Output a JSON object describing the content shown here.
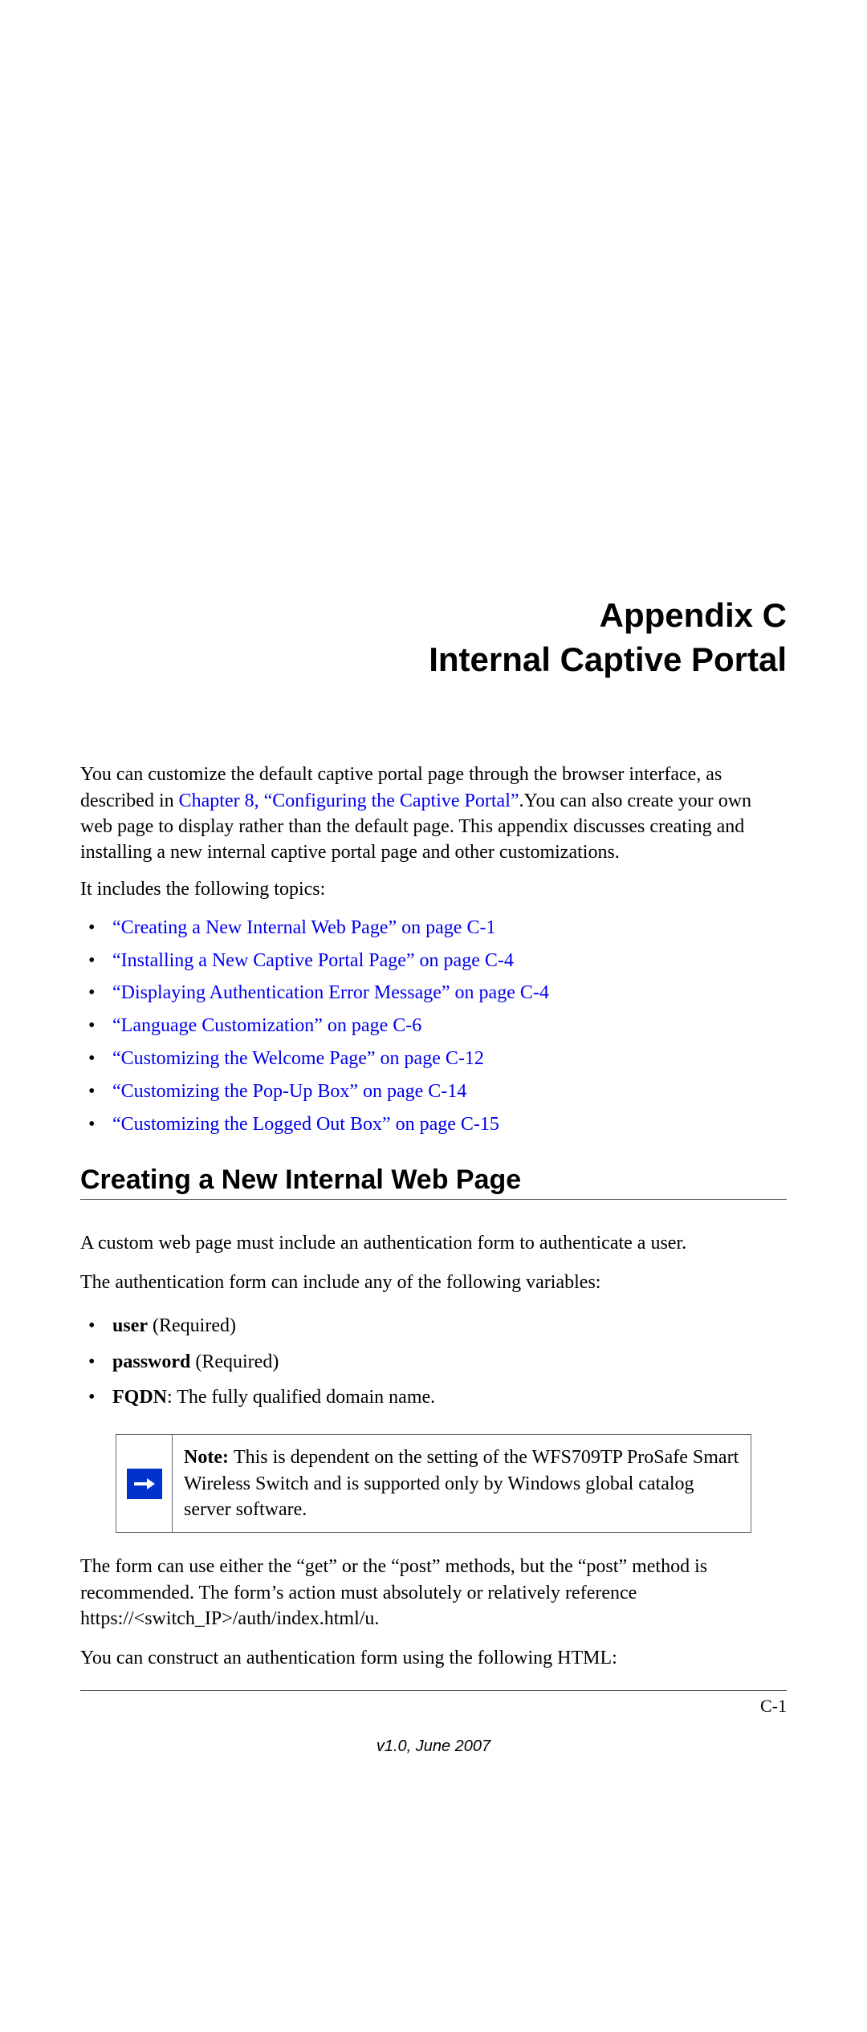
{
  "title": {
    "appendix_label": "Appendix C",
    "appendix_title": "Internal Captive Portal"
  },
  "intro": {
    "part1": "You can customize the default captive portal page through the browser interface, as described in ",
    "link1": "Chapter 8, “Configuring the Captive Portal”",
    "part2": ".You can also create your own web page to display rather than the default page. This appendix discusses creating and installing a new internal captive portal page and other customizations."
  },
  "topics_heading": "It includes the following topics:",
  "topics": [
    "“Creating a New Internal Web Page” on page C-1",
    "“Installing a New Captive Portal Page” on page C-4",
    "“Displaying Authentication Error Message” on page C-4",
    "“Language Customization” on page C-6",
    "“Customizing the Welcome Page” on page C-12",
    "“Customizing the Pop-Up Box” on page C-14",
    "“Customizing the Logged Out Box” on page C-15"
  ],
  "section_heading": "Creating a New Internal Web Page",
  "custom_page_intro": "A custom web page must include an authentication form to authenticate a user.",
  "vars_heading": "The authentication form can include any of the following variables:",
  "vars": {
    "user_bold": "user",
    "user_tail": " (Required)",
    "password_bold": "password",
    "password_tail": " (Required)",
    "fqdn_bold": "FQDN",
    "fqdn_tail": ": The fully qualified domain name."
  },
  "note": {
    "label": "Note: ",
    "text": "This is dependent on the setting of the WFS709TP ProSafe Smart Wireless Switch and is supported only by Windows global catalog server software."
  },
  "form_method_para": "The form can use either the “get” or the “post” methods, but the “post” method is recommended. The form’s action must absolutely or relatively reference https://<switch_IP>/auth/index.html/u.",
  "construct_para": "You can construct an authentication form using the following HTML:",
  "footer": {
    "page_number": "C-1",
    "version": "v1.0, June 2007"
  }
}
